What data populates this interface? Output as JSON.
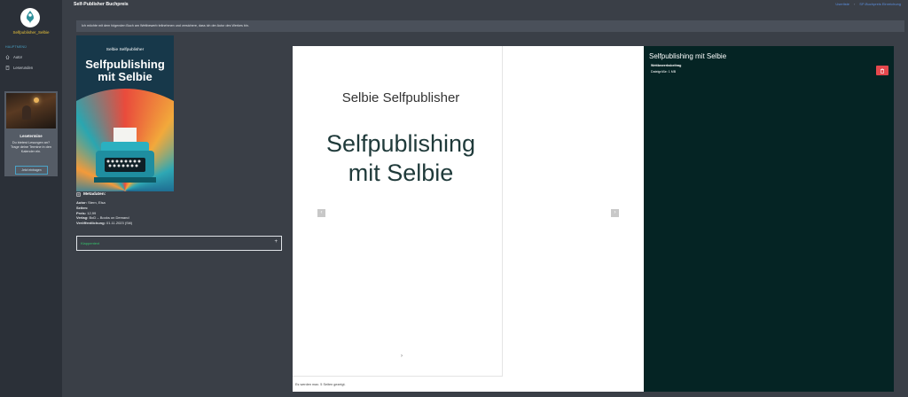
{
  "app": {
    "page_title": "Self-Publisher Buchpreis",
    "breadcrumb": [
      "Userliste",
      "SP-Buchpreis Einreichung"
    ]
  },
  "sidebar": {
    "username": "Selfpublisher_Selbie",
    "section_label": "HAUPTMENÜ",
    "items": [
      {
        "label": "Autor",
        "icon": "home-icon"
      },
      {
        "label": "Leserunden",
        "icon": "book-icon"
      }
    ],
    "promo": {
      "title": "Lesetermine",
      "text": "Du bietest Lesungen an? Trage deine Termine in den Kalender ein.",
      "button": "Jetzt eintragen"
    }
  },
  "notice": "Ich möchte mit dem folgenden Buch am Wettbewerb teilnehmen und versichere, dass ich der Autor des Werkes bin.",
  "book": {
    "cover_author": "Selbie Selfpublisher",
    "cover_title": "Selfpublishing mit Selbie",
    "metadata_heading": "Metadaten:",
    "metadata": [
      {
        "key": "Autor:",
        "value": "Stern, Elsa"
      },
      {
        "key": "Seiten:",
        "value": ""
      },
      {
        "key": "Preis:",
        "value": "12,99"
      },
      {
        "key": "Verlag:",
        "value": "BoD – Books on Demand"
      },
      {
        "key": "Veröffentlichung:",
        "value": "01.11.2023 (Stil)"
      }
    ],
    "collapse_label": "Klappentext",
    "collapse_toggle": "+"
  },
  "viewer": {
    "author": "Selbie Selfpublisher",
    "title_line1": "Selfpublishing",
    "title_line2": "mit Selbie",
    "prev": "‹",
    "next": "›",
    "page_nav": "›",
    "footnote": "Es werden max. 5 Seiten gezeigt."
  },
  "panel": {
    "title": "Selfpublishing mit Selbie",
    "line1": "Wettbewerbsbeitrag",
    "line2": "Dateigröße: 1 MB"
  },
  "colors": {
    "sidebar_bg": "#2b3038",
    "body_bg": "#3a3f47",
    "accent_link": "#5b8ede",
    "accent_green": "#36c26c",
    "panel_bg": "#052424",
    "delete_red": "#e5484d"
  }
}
